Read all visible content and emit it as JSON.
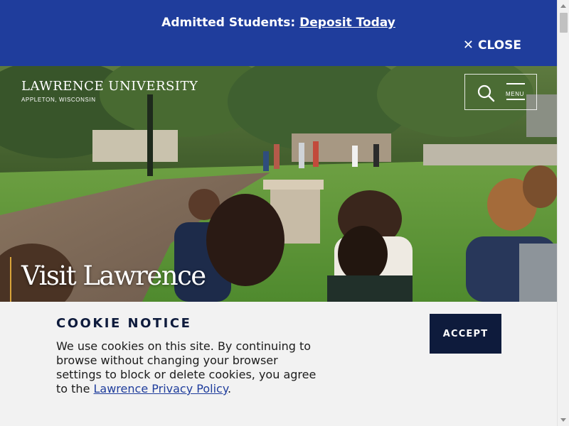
{
  "alert": {
    "prefix": "Admitted Students:",
    "link_label": "Deposit Today",
    "close_label": "CLOSE",
    "bg_color": "#1f3d9c"
  },
  "header": {
    "logo_name": "LAWRENCE UNIVERSITY",
    "logo_location": "APPLETON, WISCONSIN",
    "search_icon": "search-icon",
    "menu_label": "MENU",
    "menu_icon": "hamburger-icon"
  },
  "hero": {
    "title": "Visit Lawrence",
    "accent_color": "#d9a43a"
  },
  "cookie_notice": {
    "title": "COOKIE NOTICE",
    "body_text": "We use cookies on this site. By continuing to browse without changing your browser settings to block or delete cookies, you agree to the",
    "link_label": "Lawrence Privacy Policy",
    "body_end": ".",
    "accept_label": "ACCEPT",
    "accent_color": "#0e1b3c"
  }
}
